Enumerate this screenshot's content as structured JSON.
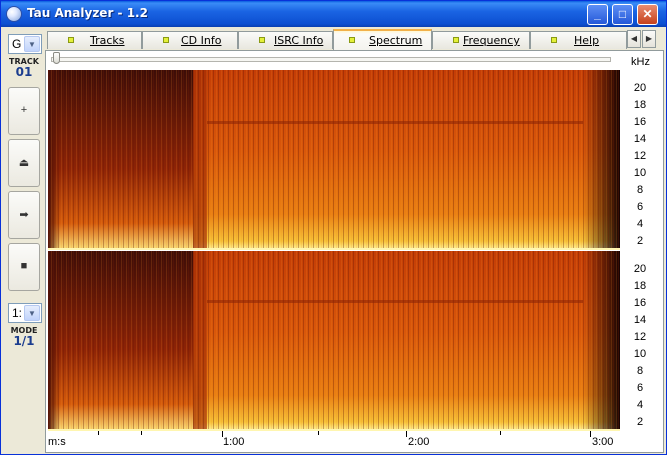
{
  "window": {
    "title": "Tau Analyzer - 1.2"
  },
  "left_panel": {
    "drive_combo_value": "G",
    "track_label": "TRACK",
    "track_value": "01",
    "buttons": [
      {
        "icon": "plus-icon",
        "glyph": "+"
      },
      {
        "icon": "eject-icon",
        "glyph": "⏏"
      },
      {
        "icon": "arrow-right-icon",
        "glyph": "➡"
      },
      {
        "icon": "stop-icon",
        "glyph": "■"
      }
    ],
    "mode_combo_value": "1:",
    "mode_label": "MODE",
    "mode_value": "1/1"
  },
  "tabs": [
    {
      "label": "Tracks",
      "active": false
    },
    {
      "label": "CD Info",
      "active": false
    },
    {
      "label": "ISRC Info",
      "active": false
    },
    {
      "label": "Spectrum",
      "active": true
    },
    {
      "label": "Frequency",
      "active": false
    },
    {
      "label": "Help",
      "active": false
    }
  ],
  "spectrum": {
    "unit_label": "kHz",
    "y_ticks": [
      "20",
      "18",
      "16",
      "14",
      "12",
      "10",
      "8",
      "6",
      "4",
      "2"
    ],
    "x_label": "m:s",
    "x_ticks": [
      "1:00",
      "2:00",
      "3:00"
    ],
    "channels": 2
  }
}
